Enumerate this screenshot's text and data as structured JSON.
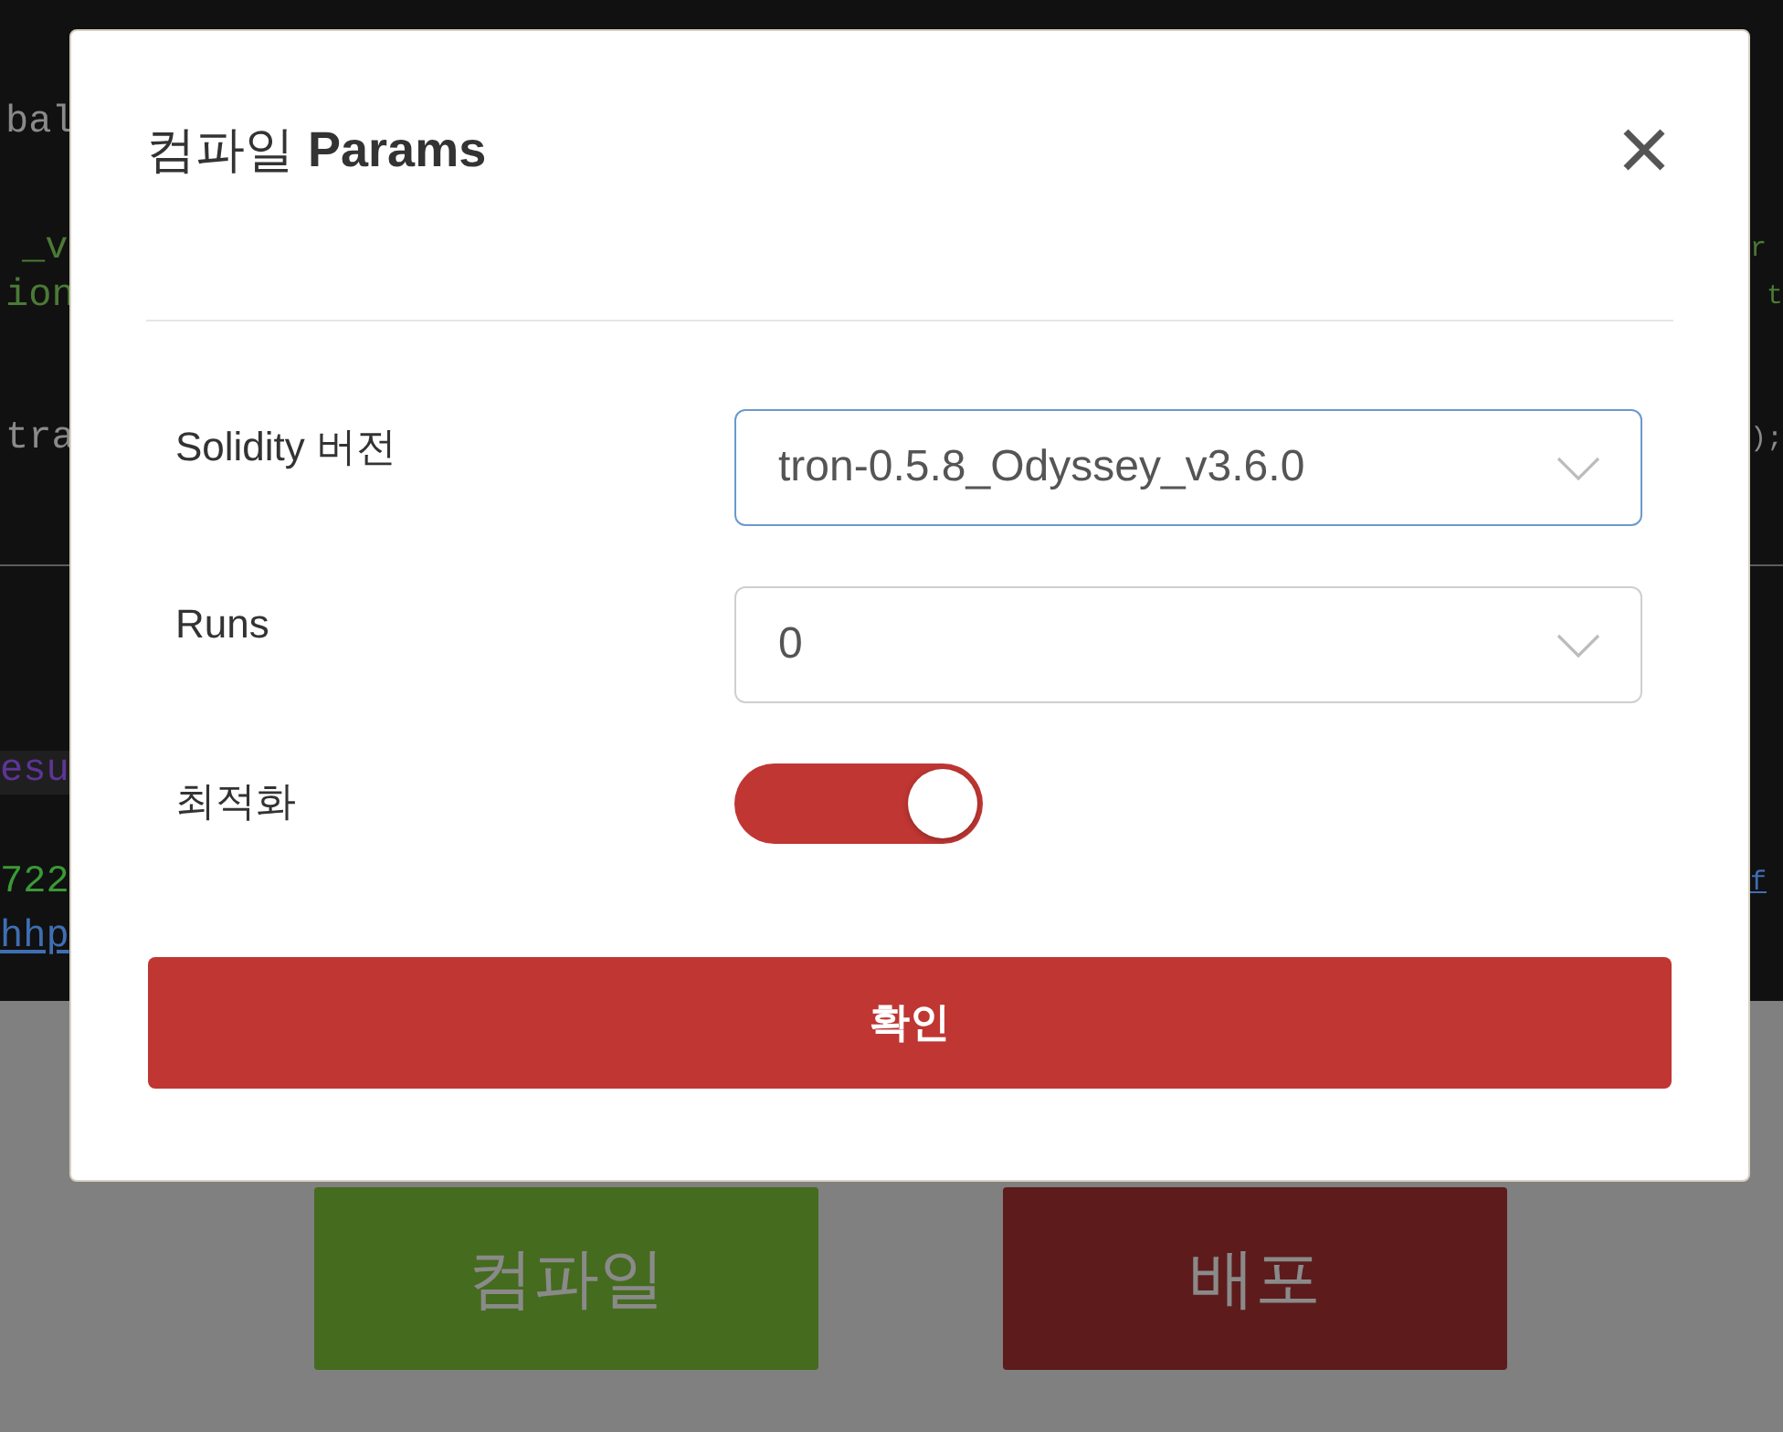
{
  "editor": {
    "lines": [
      {
        "left": {
          "text": "bal",
          "kind": "plain"
        }
      },
      {
        "left": {
          "text": "_v",
          "kind": "string"
        },
        "right": {
          "text": "r",
          "kind": "string"
        }
      },
      {
        "left": {
          "text": "ion",
          "kind": "string"
        },
        "right": {
          "text": "t",
          "kind": "string"
        }
      },
      {
        "left": {
          "text": "tra",
          "kind": "plain"
        },
        "right": {
          "text": ");",
          "kind": "plain"
        }
      }
    ]
  },
  "console": {
    "lines": [
      {
        "left": {
          "text": "esu",
          "kind": "keyword"
        },
        "highlighted": true
      },
      {
        "left": {
          "text": "722",
          "kind": "number"
        },
        "right": {
          "text": "f",
          "kind": "link"
        },
        "highlighted": false
      },
      {
        "left": {
          "text": "hhp",
          "kind": "link"
        },
        "highlighted": false
      }
    ]
  },
  "actions": [
    {
      "label": "컴파일",
      "kind": "compile"
    },
    {
      "label": "배포",
      "kind": "deploy"
    }
  ],
  "dialog": {
    "title": "컴파일 **Params**",
    "rows": [
      {
        "label": "Solidity 버전",
        "kind": "select",
        "value": "tron-0.5.8_Odyssey_v3.6.0",
        "focused": true
      },
      {
        "label": "Runs",
        "kind": "select",
        "value": "0",
        "focused": false
      },
      {
        "label": "최적화",
        "kind": "switch",
        "on": true
      }
    ],
    "confirm": "확인"
  }
}
